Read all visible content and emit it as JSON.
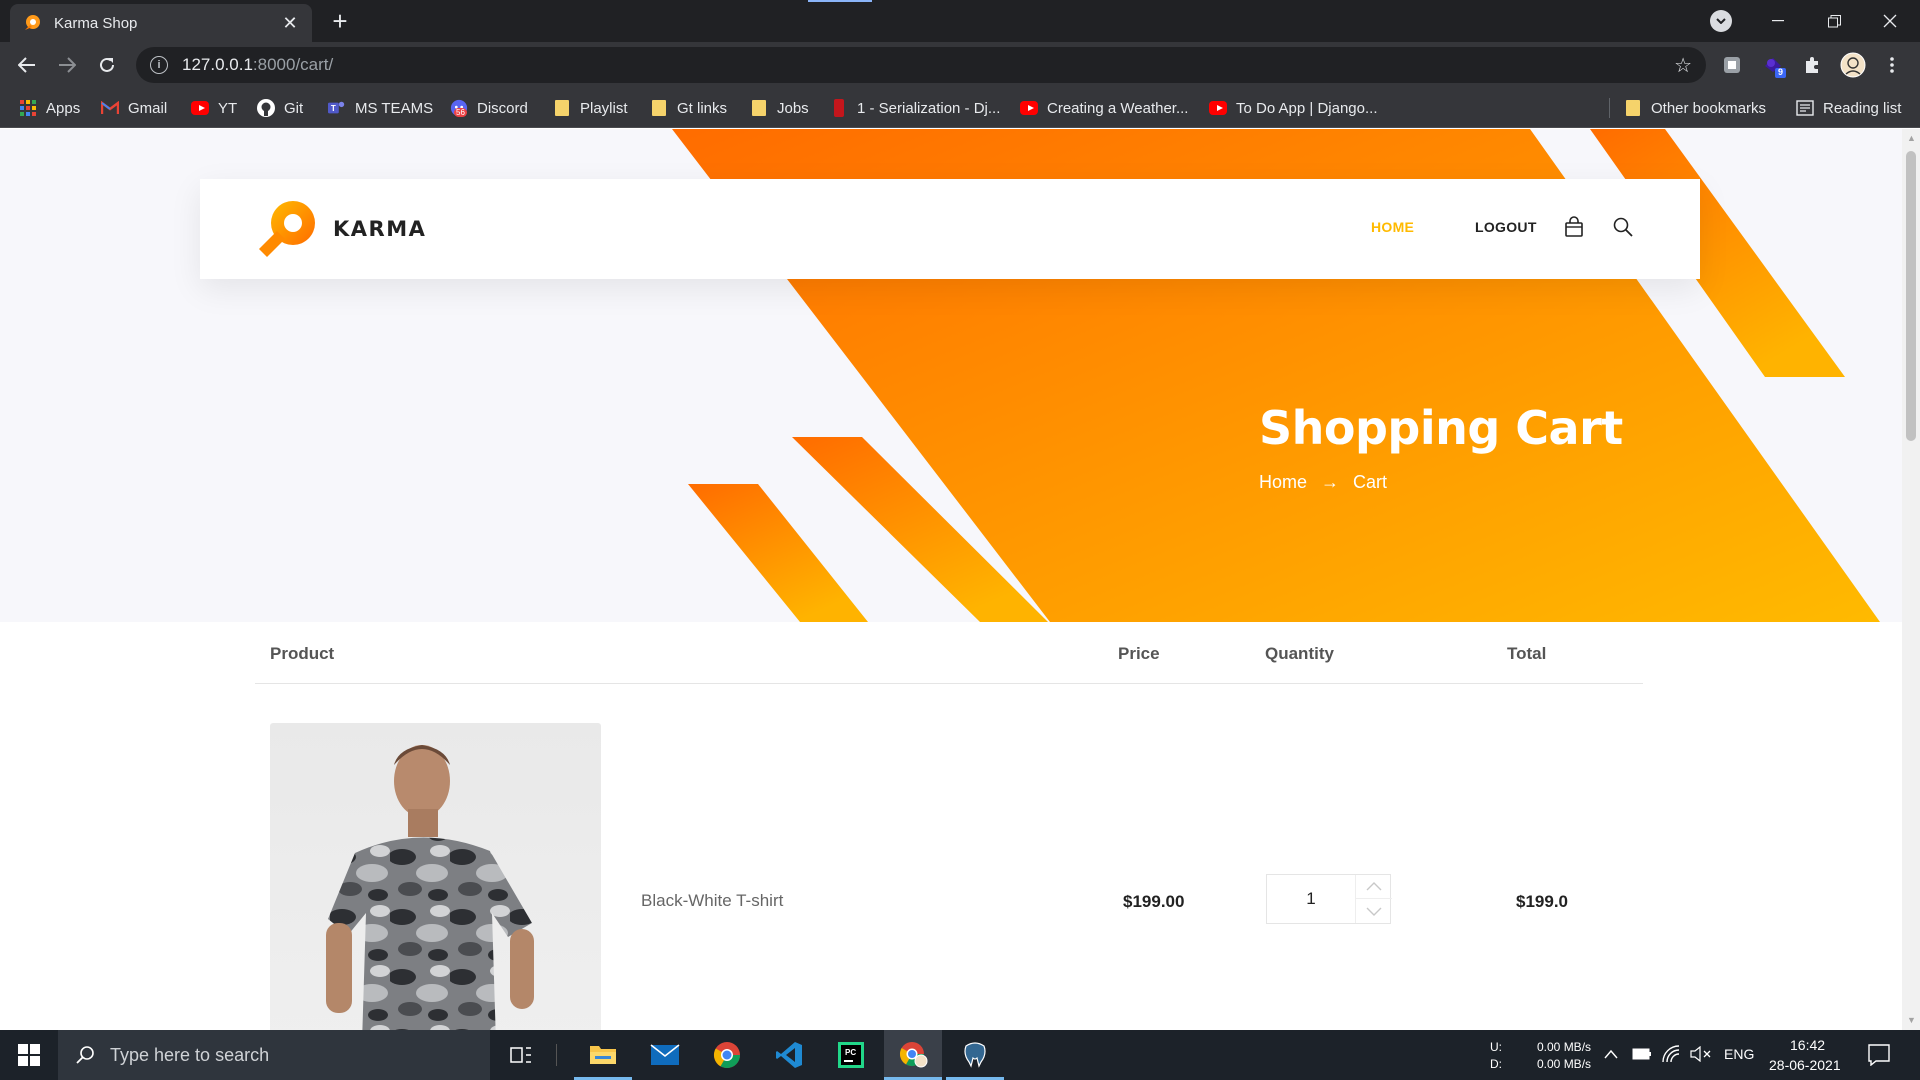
{
  "browser": {
    "tab_title": "Karma Shop",
    "tab_close": "✕",
    "new_tab": "+",
    "url_host": "127.0.0.1",
    "url_path": ":8000/cart/",
    "bookmarks": [
      {
        "label": "Apps",
        "icon": "apps-grid-icon"
      },
      {
        "label": "Gmail",
        "icon": "gmail-icon"
      },
      {
        "label": "YT",
        "icon": "youtube-icon"
      },
      {
        "label": "Git",
        "icon": "github-icon"
      },
      {
        "label": "MS TEAMS",
        "icon": "teams-icon"
      },
      {
        "label": "Discord",
        "icon": "discord-icon"
      },
      {
        "label": "Playlist",
        "icon": "folder-icon"
      },
      {
        "label": "Gt links",
        "icon": "folder-icon"
      },
      {
        "label": "Jobs",
        "icon": "folder-icon"
      },
      {
        "label": "1 - Serialization - Dj...",
        "icon": "bookmark-icon"
      },
      {
        "label": "Creating a Weather...",
        "icon": "youtube-icon"
      },
      {
        "label": "To Do App | Django...",
        "icon": "youtube-icon"
      }
    ],
    "other_bookmarks": "Other bookmarks",
    "reading_list": "Reading list",
    "extension_badge": "9",
    "discord_badge": "56"
  },
  "site": {
    "brand": "KARMA",
    "nav": {
      "home": "HOME",
      "logout": "LOGOUT"
    },
    "hero": {
      "title": "Shopping Cart",
      "breadcrumb_home": "Home",
      "breadcrumb_arrow": "→",
      "breadcrumb_current": "Cart"
    },
    "colors": {
      "accent": "#ffba00",
      "accent_dark": "#ff6c00",
      "nav_active": "#ffba00"
    }
  },
  "cart": {
    "headers": {
      "product": "Product",
      "price": "Price",
      "quantity": "Quantity",
      "total": "Total"
    },
    "items": [
      {
        "name": "Black-White T-shirt",
        "price": "$199.00",
        "quantity": "1",
        "total": "$199.0"
      }
    ]
  },
  "taskbar": {
    "search_placeholder": "Type here to search",
    "net_upload_label": "U:",
    "net_download_label": "D:",
    "net_upload": "0.00 MB/s",
    "net_download": "0.00 MB/s",
    "language": "ENG",
    "time": "16:42",
    "date": "28-06-2021"
  }
}
